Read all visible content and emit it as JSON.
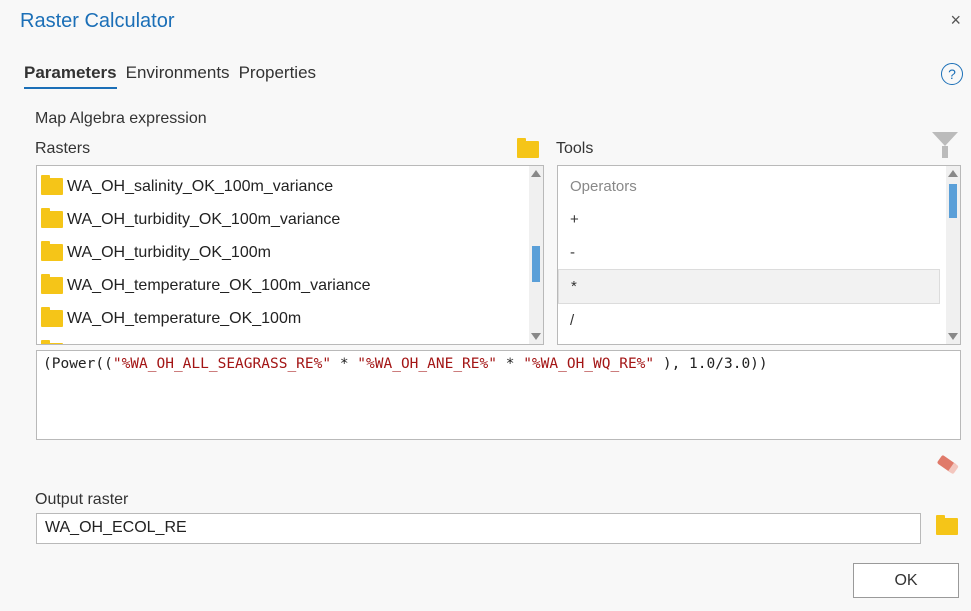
{
  "window": {
    "title": "Raster Calculator",
    "close_glyph": "×"
  },
  "tabs": [
    {
      "label": "Parameters",
      "active": true
    },
    {
      "label": "Environments",
      "active": false
    },
    {
      "label": "Properties",
      "active": false
    }
  ],
  "help_glyph": "?",
  "expression_section_label": "Map Algebra expression",
  "rasters": {
    "label": "Rasters",
    "items": [
      "WA_OH_salinity_OK_100m_variance",
      "WA_OH_turbidity_OK_100m_variance",
      "WA_OH_turbidity_OK_100m",
      "WA_OH_temperature_OK_100m_variance",
      "WA_OH_temperature_OK_100m"
    ]
  },
  "tools": {
    "label": "Tools",
    "category": "Operators",
    "items": [
      "+",
      "-",
      "*",
      "/"
    ],
    "selected": "*"
  },
  "expression": {
    "p1": "(Power((",
    "s1": "\"%WA_OH_ALL_SEAGRASS_RE%\"",
    "p2": " * ",
    "s2": "\"%WA_OH_ANE_RE%\"",
    "p3": " * ",
    "s3": "\"%WA_OH_WQ_RE%\"",
    "p4": " ), 1.0/3.0))"
  },
  "output": {
    "label": "Output raster",
    "value": "WA_OH_ECOL_RE"
  },
  "ok_label": "OK",
  "colors": {
    "accent": "#1b6fb7",
    "folder": "#f5c518",
    "string": "#a31515"
  }
}
